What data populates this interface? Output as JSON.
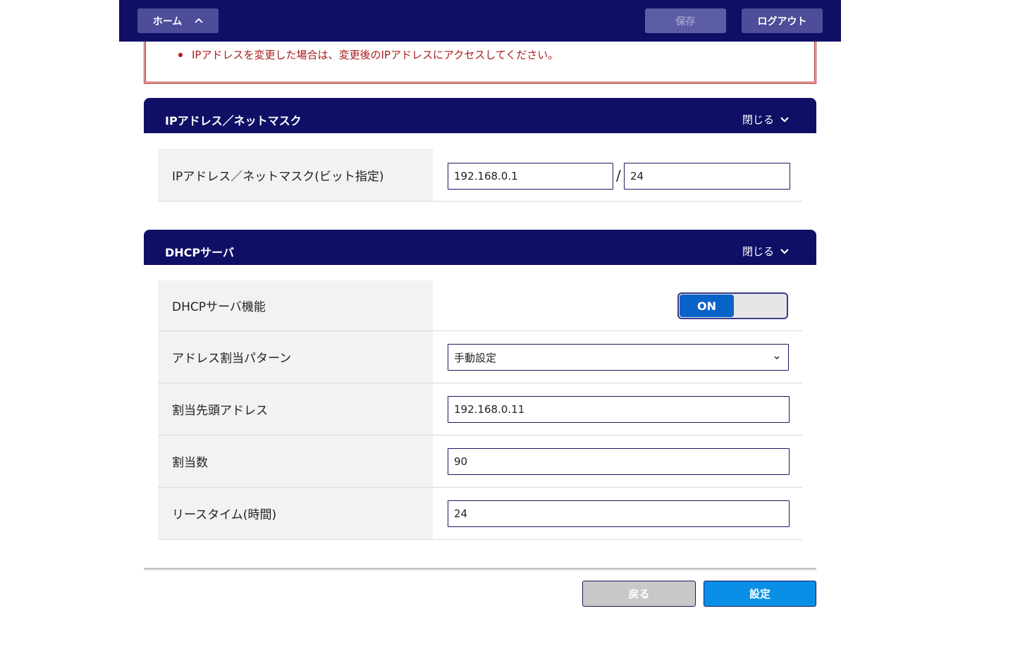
{
  "header": {
    "home_label": "ホーム",
    "home_chevron": "^",
    "save_label": "保存",
    "logout_label": "ログアウト"
  },
  "warning": {
    "message": "IPアドレスを変更した場合は、変更後のIPアドレスにアクセスしてください。"
  },
  "ip_section": {
    "title": "IPアドレス／ネットマスク",
    "toggle_label": "閉じる",
    "row_label": "IPアドレス／ネットマスク(ビット指定)",
    "ip_value": "192.168.0.1",
    "separator": "/",
    "mask_value": "24"
  },
  "dhcp_section": {
    "title": "DHCPサーバ",
    "toggle_label": "閉じる",
    "rows": [
      {
        "label": "DHCPサーバ機能",
        "value": "ON"
      },
      {
        "label": "アドレス割当パターン",
        "value": "手動設定"
      },
      {
        "label": "割当先頭アドレス",
        "value": "192.168.0.11"
      },
      {
        "label": "割当数",
        "value": "90"
      },
      {
        "label": "リースタイム(時間)",
        "value": "24"
      }
    ]
  },
  "footer": {
    "back_label": "戻る",
    "submit_label": "設定"
  },
  "colors": {
    "header_bg": "#0f0f66",
    "warning_text": "#a81c1c",
    "toggle_on": "#0a63c9",
    "submit_bg": "#0a8fe6"
  }
}
